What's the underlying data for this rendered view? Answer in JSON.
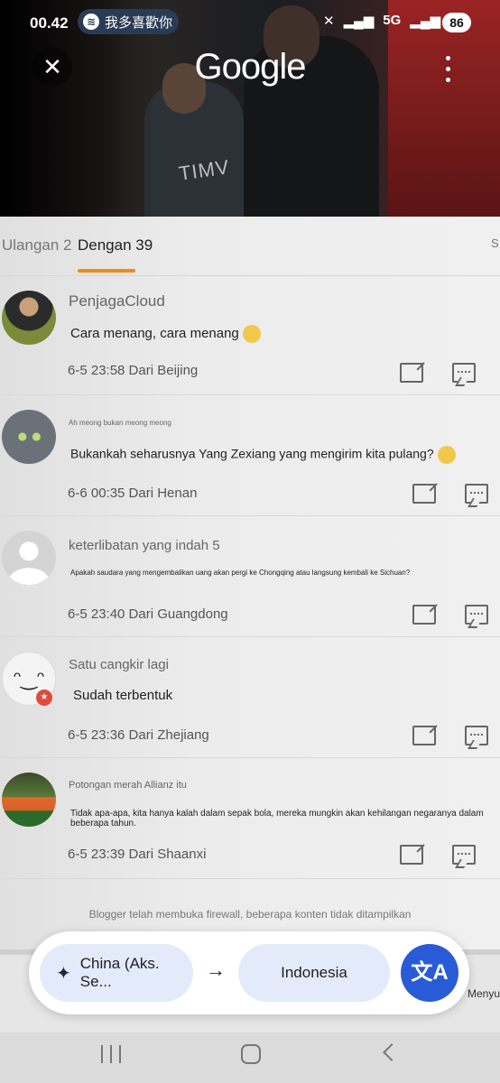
{
  "status_bar": {
    "time": "00.42",
    "media_app": "spotify-icon",
    "media_text": "我多喜歡你",
    "signal": "5G",
    "battery": "86"
  },
  "header": {
    "logo": "Google",
    "photo_text": "TIMV"
  },
  "tabs": [
    {
      "label": "Ulangan 2"
    },
    {
      "label": "Dengan 39"
    },
    {
      "label": "S"
    }
  ],
  "comments": [
    {
      "user": "PenjagaCloud",
      "text": "Cara menang, cara menang",
      "meta": "6-5 23:58 Dari Beijing"
    },
    {
      "user": "Ah meong bukan meong meong",
      "text": "Bukankah seharusnya Yang Zexiang yang mengirim kita pulang?",
      "meta": "6-6 00:35 Dari Henan"
    },
    {
      "user": "keterlibatan yang indah 5",
      "text": "Apakah saudara yang mengembalikan uang akan pergi ke Chongqing atau langsung kembali ke Sichuan?",
      "meta": "6-5 23:40 Dari Guangdong"
    },
    {
      "user": "Satu cangkir lagi",
      "text": "Sudah terbentuk",
      "meta": "6-5 23:36 Dari Zhejiang"
    },
    {
      "user": "Potongan merah Allianz itu",
      "text": "Tidak apa-apa, kita hanya kalah dalam sepak bola, mereka mungkin akan kehilangan negaranya dalam beberapa tahun.",
      "meta": "6-5 23:39 Dari Shaanxi"
    }
  ],
  "notice": "Blogger telah membuka firewall, beberapa konten tidak ditampilkan",
  "translate": {
    "source_lang": "China (Aks. Se...",
    "target_lang": "Indonesia"
  },
  "behind_text": "Menyuka",
  "colors": {
    "accent": "#f08a1a",
    "translate_blue": "#2a5bd7",
    "chip_bg": "#e3ebfb"
  }
}
